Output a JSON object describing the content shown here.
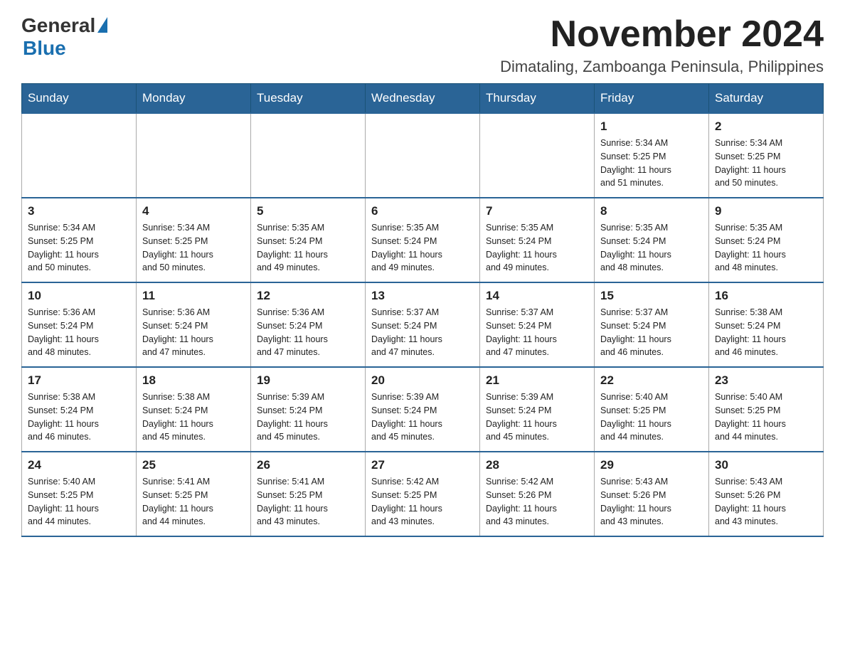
{
  "header": {
    "logo_general": "General",
    "logo_blue": "Blue",
    "month_title": "November 2024",
    "subtitle": "Dimataling, Zamboanga Peninsula, Philippines"
  },
  "weekdays": [
    "Sunday",
    "Monday",
    "Tuesday",
    "Wednesday",
    "Thursday",
    "Friday",
    "Saturday"
  ],
  "weeks": [
    [
      {
        "day": "",
        "info": ""
      },
      {
        "day": "",
        "info": ""
      },
      {
        "day": "",
        "info": ""
      },
      {
        "day": "",
        "info": ""
      },
      {
        "day": "",
        "info": ""
      },
      {
        "day": "1",
        "info": "Sunrise: 5:34 AM\nSunset: 5:25 PM\nDaylight: 11 hours\nand 51 minutes."
      },
      {
        "day": "2",
        "info": "Sunrise: 5:34 AM\nSunset: 5:25 PM\nDaylight: 11 hours\nand 50 minutes."
      }
    ],
    [
      {
        "day": "3",
        "info": "Sunrise: 5:34 AM\nSunset: 5:25 PM\nDaylight: 11 hours\nand 50 minutes."
      },
      {
        "day": "4",
        "info": "Sunrise: 5:34 AM\nSunset: 5:25 PM\nDaylight: 11 hours\nand 50 minutes."
      },
      {
        "day": "5",
        "info": "Sunrise: 5:35 AM\nSunset: 5:24 PM\nDaylight: 11 hours\nand 49 minutes."
      },
      {
        "day": "6",
        "info": "Sunrise: 5:35 AM\nSunset: 5:24 PM\nDaylight: 11 hours\nand 49 minutes."
      },
      {
        "day": "7",
        "info": "Sunrise: 5:35 AM\nSunset: 5:24 PM\nDaylight: 11 hours\nand 49 minutes."
      },
      {
        "day": "8",
        "info": "Sunrise: 5:35 AM\nSunset: 5:24 PM\nDaylight: 11 hours\nand 48 minutes."
      },
      {
        "day": "9",
        "info": "Sunrise: 5:35 AM\nSunset: 5:24 PM\nDaylight: 11 hours\nand 48 minutes."
      }
    ],
    [
      {
        "day": "10",
        "info": "Sunrise: 5:36 AM\nSunset: 5:24 PM\nDaylight: 11 hours\nand 48 minutes."
      },
      {
        "day": "11",
        "info": "Sunrise: 5:36 AM\nSunset: 5:24 PM\nDaylight: 11 hours\nand 47 minutes."
      },
      {
        "day": "12",
        "info": "Sunrise: 5:36 AM\nSunset: 5:24 PM\nDaylight: 11 hours\nand 47 minutes."
      },
      {
        "day": "13",
        "info": "Sunrise: 5:37 AM\nSunset: 5:24 PM\nDaylight: 11 hours\nand 47 minutes."
      },
      {
        "day": "14",
        "info": "Sunrise: 5:37 AM\nSunset: 5:24 PM\nDaylight: 11 hours\nand 47 minutes."
      },
      {
        "day": "15",
        "info": "Sunrise: 5:37 AM\nSunset: 5:24 PM\nDaylight: 11 hours\nand 46 minutes."
      },
      {
        "day": "16",
        "info": "Sunrise: 5:38 AM\nSunset: 5:24 PM\nDaylight: 11 hours\nand 46 minutes."
      }
    ],
    [
      {
        "day": "17",
        "info": "Sunrise: 5:38 AM\nSunset: 5:24 PM\nDaylight: 11 hours\nand 46 minutes."
      },
      {
        "day": "18",
        "info": "Sunrise: 5:38 AM\nSunset: 5:24 PM\nDaylight: 11 hours\nand 45 minutes."
      },
      {
        "day": "19",
        "info": "Sunrise: 5:39 AM\nSunset: 5:24 PM\nDaylight: 11 hours\nand 45 minutes."
      },
      {
        "day": "20",
        "info": "Sunrise: 5:39 AM\nSunset: 5:24 PM\nDaylight: 11 hours\nand 45 minutes."
      },
      {
        "day": "21",
        "info": "Sunrise: 5:39 AM\nSunset: 5:24 PM\nDaylight: 11 hours\nand 45 minutes."
      },
      {
        "day": "22",
        "info": "Sunrise: 5:40 AM\nSunset: 5:25 PM\nDaylight: 11 hours\nand 44 minutes."
      },
      {
        "day": "23",
        "info": "Sunrise: 5:40 AM\nSunset: 5:25 PM\nDaylight: 11 hours\nand 44 minutes."
      }
    ],
    [
      {
        "day": "24",
        "info": "Sunrise: 5:40 AM\nSunset: 5:25 PM\nDaylight: 11 hours\nand 44 minutes."
      },
      {
        "day": "25",
        "info": "Sunrise: 5:41 AM\nSunset: 5:25 PM\nDaylight: 11 hours\nand 44 minutes."
      },
      {
        "day": "26",
        "info": "Sunrise: 5:41 AM\nSunset: 5:25 PM\nDaylight: 11 hours\nand 43 minutes."
      },
      {
        "day": "27",
        "info": "Sunrise: 5:42 AM\nSunset: 5:25 PM\nDaylight: 11 hours\nand 43 minutes."
      },
      {
        "day": "28",
        "info": "Sunrise: 5:42 AM\nSunset: 5:26 PM\nDaylight: 11 hours\nand 43 minutes."
      },
      {
        "day": "29",
        "info": "Sunrise: 5:43 AM\nSunset: 5:26 PM\nDaylight: 11 hours\nand 43 minutes."
      },
      {
        "day": "30",
        "info": "Sunrise: 5:43 AM\nSunset: 5:26 PM\nDaylight: 11 hours\nand 43 minutes."
      }
    ]
  ]
}
